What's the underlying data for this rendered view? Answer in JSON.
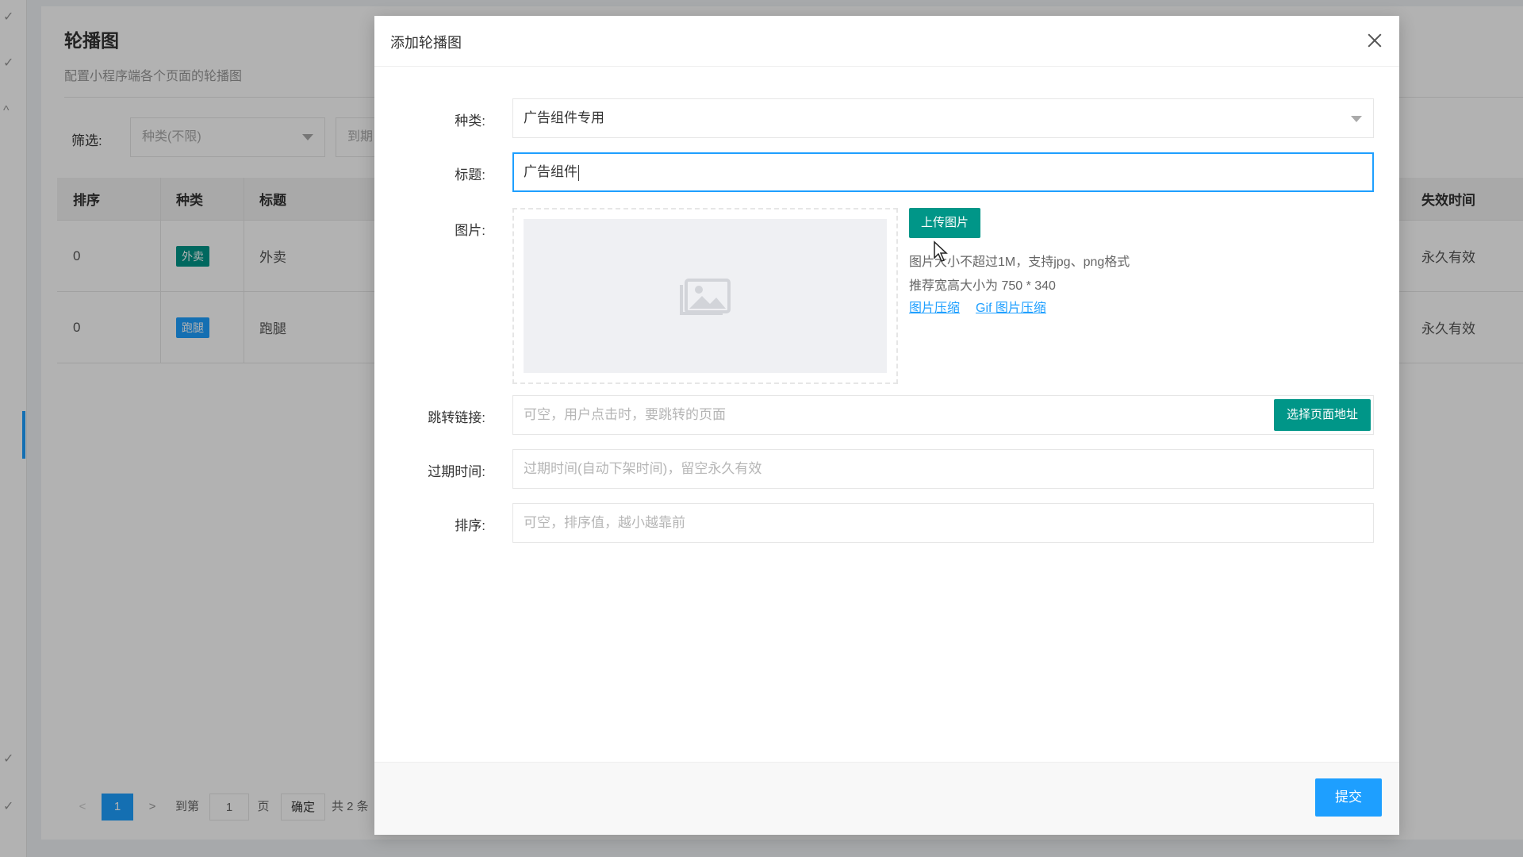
{
  "page": {
    "title": "轮播图",
    "subtitle": "配置小程序端各个页面的轮播图",
    "filter_label": "筛选:",
    "filter_select_placeholder": "种类(不限)",
    "filter_select2_placeholder": "到期"
  },
  "table": {
    "headers": [
      "排序",
      "种类",
      "标题",
      "失效时间"
    ],
    "rows": [
      {
        "order": "0",
        "type": "外卖",
        "type_color": "#009688",
        "title": "外卖",
        "expire": "永久有效"
      },
      {
        "order": "0",
        "type": "跑腿",
        "type_color": "#1e9fff",
        "title": "跑腿",
        "expire": "永久有效"
      }
    ]
  },
  "pager": {
    "prev": "<",
    "current": "1",
    "next": ">",
    "goto_label": "到第",
    "goto_value": "1",
    "page_unit": "页",
    "confirm": "确定",
    "total": "共 2 条"
  },
  "modal": {
    "title": "添加轮播图",
    "fields": {
      "type_label": "种类:",
      "type_value": "广告组件专用",
      "title_label": "标题:",
      "title_value": "广告组件",
      "image_label": "图片:",
      "upload_button": "上传图片",
      "image_hint_1": "图片大小不超过1M，支持jpg、png格式",
      "image_hint_2": "推荐宽高大小为 750 * 340",
      "compress_link": "图片压缩",
      "gif_compress_link": "Gif 图片压缩",
      "link_label": "跳转链接:",
      "link_placeholder": "可空，用户点击时，要跳转的页面",
      "select_page_button": "选择页面地址",
      "expire_label": "过期时间:",
      "expire_placeholder": "过期时间(自动下架时间)，留空永久有效",
      "sort_label": "排序:",
      "sort_placeholder": "可空，排序值，越小越靠前"
    },
    "submit_button": "提交"
  },
  "colors": {
    "accent": "#1e9fff",
    "teal": "#009688"
  }
}
